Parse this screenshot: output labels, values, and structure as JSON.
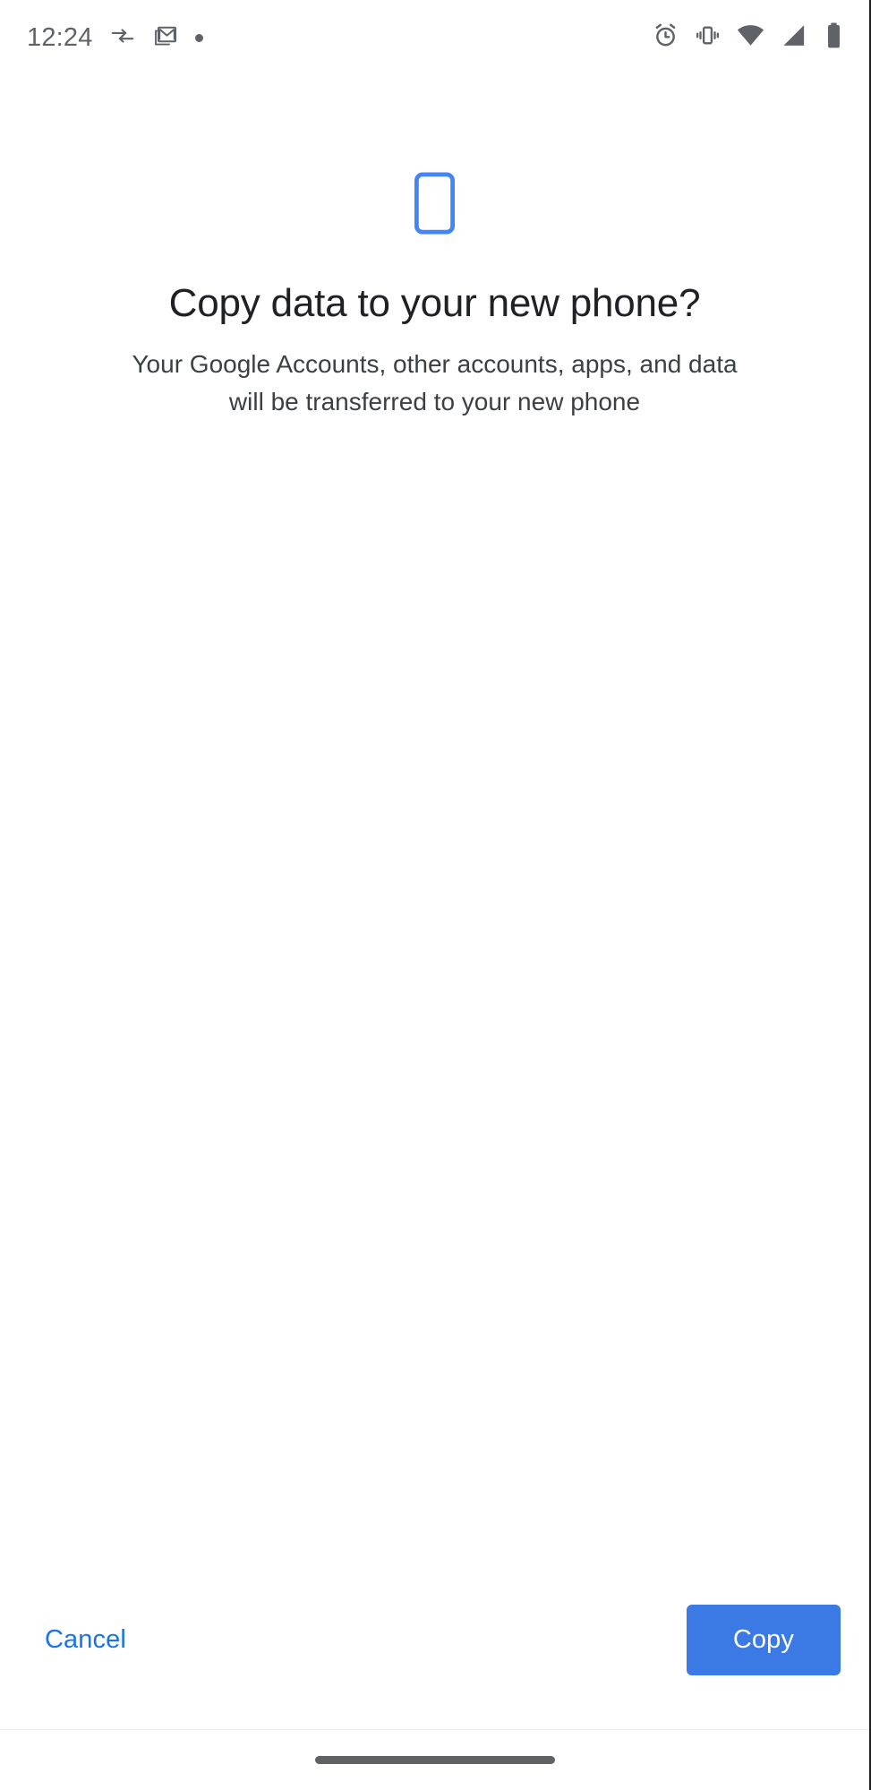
{
  "status_bar": {
    "clock": "12:24",
    "left_icons": [
      {
        "name": "data-transfer-icon",
        "label": "data transfer"
      },
      {
        "name": "gmail-icon",
        "label": "Gmail"
      },
      {
        "name": "notification-dot-icon",
        "label": "notification"
      }
    ],
    "right_icons": [
      {
        "name": "alarm-icon",
        "label": "Alarm set"
      },
      {
        "name": "vibrate-icon",
        "label": "Vibrate mode"
      },
      {
        "name": "wifi-icon",
        "label": "Wi-Fi"
      },
      {
        "name": "cellular-signal-icon",
        "label": "Cellular signal"
      },
      {
        "name": "battery-icon",
        "label": "Battery"
      }
    ]
  },
  "hero": {
    "icon": "smartphone-icon",
    "icon_color": "#4285f4"
  },
  "main": {
    "title": "Copy data to your new phone?",
    "subtitle": "Your Google Accounts, other accounts, apps, and data will be transferred to your new phone"
  },
  "actions": {
    "cancel_label": "Cancel",
    "copy_label": "Copy",
    "cancel_color": "#1a73e8",
    "copy_bg_color": "#3b7ae4",
    "copy_text_color": "#ffffff"
  },
  "nav_bar": {
    "gesture_handle": "home-gesture-pill",
    "color": "#5f6368"
  }
}
